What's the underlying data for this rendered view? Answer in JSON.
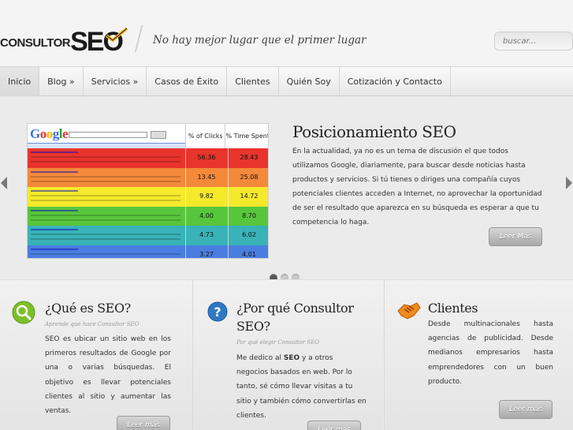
{
  "header": {
    "logo_small": "CONSULTOR",
    "logo_big": "SEO",
    "tagline": "No hay mejor lugar que el primer lugar",
    "search_placeholder": "buscar..."
  },
  "nav": {
    "items": [
      "Inicio",
      "Blog »",
      "Servicios »",
      "Casos de Éxito",
      "Clientes",
      "Quién Soy",
      "Cotización y Contacto"
    ],
    "active_index": 0
  },
  "slider": {
    "title": "Posicionamiento SEO",
    "text": "En la actualidad, ya no es un tema de discusión el que todos utilizamos Google, diariamente, para buscar desde noticias hasta productos y servicios. Si tú tienes o diriges una compañía cuyos potenciales clientes acceden a Internet, no aprovechar la oportunidad de ser el resultado que aparezca en su búsqueda es esperar a que tu competencia lo haga.",
    "button": "Leer Más",
    "image": {
      "logo": "Google",
      "col_clicks": "% of Clicks",
      "col_time": "% Time Spent",
      "rows": [
        {
          "clicks": "56.36",
          "time": "28.43",
          "color": "#e8342c"
        },
        {
          "clicks": "13.45",
          "time": "25.08",
          "color": "#f4893a"
        },
        {
          "clicks": "9.82",
          "time": "14.72",
          "color": "#f5e92c"
        },
        {
          "clicks": "4.00",
          "time": "8.70",
          "color": "#58c63c"
        },
        {
          "clicks": "4.73",
          "time": "6.02",
          "color": "#39b2b8"
        },
        {
          "clicks": "3.27",
          "time": "4.01",
          "color": "#4a7de0"
        }
      ]
    },
    "dots": 3,
    "active_dot": 0
  },
  "cards": [
    {
      "title": "¿Qué es SEO?",
      "subtitle": "Aprende qué hace Consultor SEO",
      "text": "SEO es ubicar un sitio web en los primeros resultados de Google por una o varias búsquedas. El objetivo es llevar potenciales clientes al sitio y aumentar las ventas.",
      "button": "Leer más",
      "icon": "search-icon"
    },
    {
      "title": "¿Por qué Consultor SEO?",
      "subtitle": "Por qué elegir Consultor SEO",
      "text_before": "Me dedico al ",
      "text_bold": "SEO",
      "text_after": " y a otros negocios basados en web. Por lo tanto, sé cómo llevar visitas a tu sitio y también cómo convertirlas en clientes.",
      "button": "Leer más",
      "icon": "question-icon"
    },
    {
      "title": "Clientes",
      "text": "Desde multinacionales hasta agencias de publicidad. Desde medianos empresarios hasta emprendedores con un buen producto.",
      "button": "Leer más",
      "icon": "handshake-icon"
    }
  ],
  "colors": {
    "background": "#ececec",
    "button": "#b0b0b0",
    "logo_accent": "#f2b51d"
  }
}
